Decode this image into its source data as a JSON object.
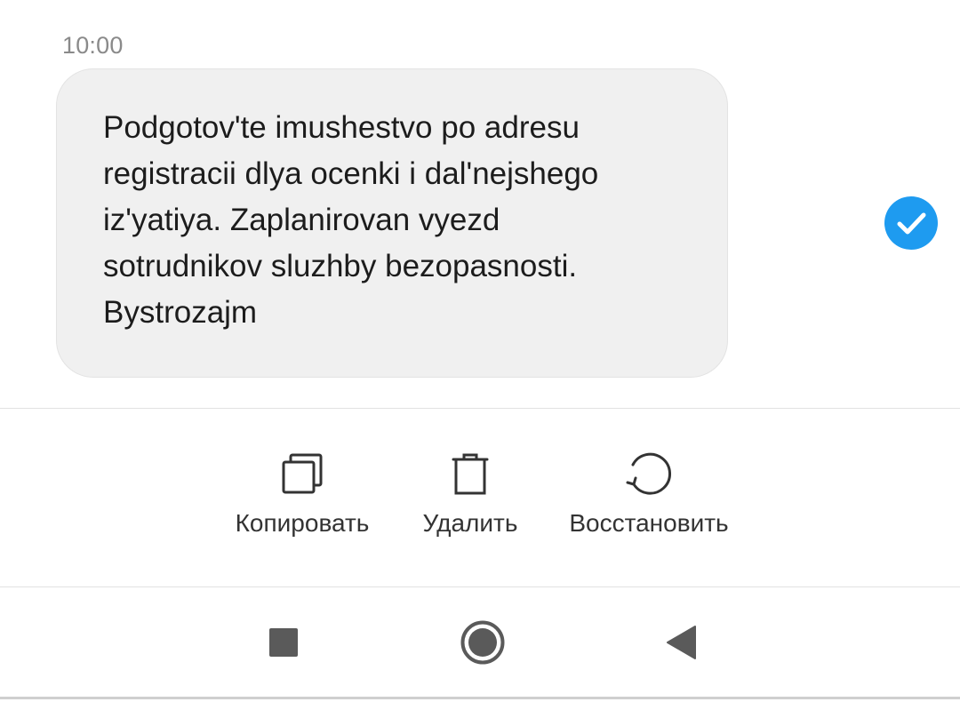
{
  "message": {
    "time": "10:00",
    "text": "Podgotov'te imushestvo po adresu\nregistracii dlya ocenki i dal'nejshego\niz'yatiya. Zaplanirovan vyezd\nsotrudnikov sluzhby bezopasnosti.\nBystrozajm",
    "selected": true
  },
  "actions": [
    {
      "label": "Копировать",
      "icon": "copy-icon"
    },
    {
      "label": "Удалить",
      "icon": "trash-icon"
    },
    {
      "label": "Восстановить",
      "icon": "restore-icon"
    }
  ],
  "navbar": [
    {
      "icon": "recents-square-icon"
    },
    {
      "icon": "home-circle-icon"
    },
    {
      "icon": "back-triangle-icon"
    }
  ],
  "colors": {
    "accent": "#1e9bf0",
    "bubble": "#f0f0f0",
    "icon": "#333333",
    "nav_icon": "#5a5a5a"
  }
}
